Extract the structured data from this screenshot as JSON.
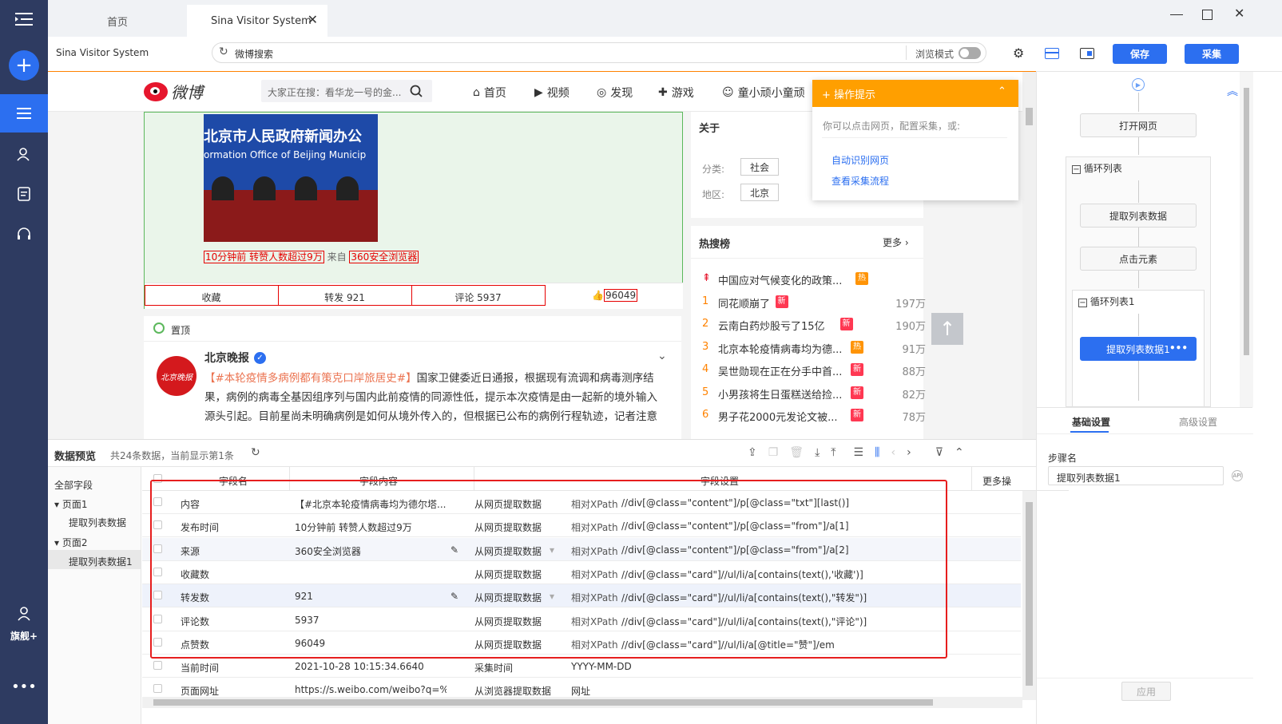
{
  "tabs": [
    {
      "label": "首页"
    },
    {
      "label": "Sina Visitor System"
    }
  ],
  "addr": {
    "title": "Sina Visitor System",
    "url": "微博搜索",
    "mode_label": "浏览模式",
    "save": "保存",
    "collect": "采集"
  },
  "nav": {
    "user_label": "旗舰+"
  },
  "weibo": {
    "logo": "微博",
    "search_placeholder": "大家正在搜：看华龙一号的金...",
    "nav": [
      "首页",
      "视频",
      "发现",
      "游戏",
      "童小顽小童顽"
    ],
    "post_image_text1": "北京市人民政府新闻办公",
    "post_image_text2": "ormation Office of Beijing Municip",
    "meta_time": "10分钟前 转赞人数超过9万",
    "meta_from": "来自",
    "meta_source": "360安全浏览器",
    "actions": [
      "收藏",
      "转发 921",
      "评论 5937"
    ],
    "likes": "96049",
    "top_label": "置顶",
    "author": "北京晚报",
    "avatar_text": "北京晚报",
    "post_tag": "【#本轮疫情多病例都有策克口岸旅居史#】",
    "post_text": "国家卫健委近日通报，根据现有流调和病毒测序结果，病例的病毒全基因组序列与国内此前疫情的同源性低，提示本次疫情是由一起新的境外输入源头引起。目前星尚未明确病例是如何从境外传入的，但根据已公布的病例行程轨迹，记者注意",
    "about_title": "关于",
    "category_label": "分类:",
    "category_value": "社会",
    "region_label": "地区:",
    "region_value": "北京",
    "hot_title": "热搜榜",
    "hot_more": "更多",
    "hot_items": [
      {
        "rank": "",
        "text": "中国应对气候变化的政策...",
        "badge": "热",
        "count": ""
      },
      {
        "rank": "1",
        "text": "同花顺崩了",
        "badge": "新",
        "count": "197万"
      },
      {
        "rank": "2",
        "text": "云南白药炒股亏了15亿",
        "badge": "新",
        "count": "190万"
      },
      {
        "rank": "3",
        "text": "北京本轮疫情病毒均为德...",
        "badge": "热",
        "count": "91万"
      },
      {
        "rank": "4",
        "text": "吴世勋现在正在分手中首...",
        "badge": "新",
        "count": "88万"
      },
      {
        "rank": "5",
        "text": "小男孩将生日蛋糕送给捡...",
        "badge": "新",
        "count": "82万"
      },
      {
        "rank": "6",
        "text": "男子花2000元发论文被...",
        "badge": "新",
        "count": "78万"
      }
    ]
  },
  "tips": {
    "title": "操作提示",
    "desc": "你可以点击网页，配置采集，或:",
    "link1": "自动识别网页",
    "link2": "查看采集流程"
  },
  "flow": {
    "open": "打开网页",
    "loop1": "循环列表",
    "extract": "提取列表数据",
    "click": "点击元素",
    "loop2": "循环列表1",
    "extract1": "提取列表数据1"
  },
  "step": {
    "tab1": "基础设置",
    "tab2": "高级设置",
    "name_label": "步骤名",
    "name_value": "提取列表数据1",
    "apply": "应用"
  },
  "preview": {
    "title": "数据预览",
    "info": "共24条数据，当前显示第1条",
    "tree": [
      "全部字段",
      "页面1",
      "提取列表数据",
      "页面2",
      "提取列表数据1"
    ],
    "headers": [
      "字段名",
      "字段内容",
      "字段设置",
      "更多操"
    ],
    "rows": [
      {
        "name": "内容",
        "content": "【#北京本轮疫情病毒均为德尔塔...",
        "type": "从网页提取数据",
        "mode": "相对XPath",
        "xpath": "//div[@class=\"content\"]/p[@class=\"txt\"][last()]"
      },
      {
        "name": "发布时间",
        "content": "10分钟前 转赞人数超过9万",
        "type": "从网页提取数据",
        "mode": "相对XPath",
        "xpath": "//div[@class=\"content\"]/p[@class=\"from\"]/a[1]"
      },
      {
        "name": "来源",
        "content": "360安全浏览器",
        "type": "从网页提取数据",
        "mode": "相对XPath",
        "xpath": "//div[@class=\"content\"]/p[@class=\"from\"]/a[2]"
      },
      {
        "name": "收藏数",
        "content": "",
        "type": "从网页提取数据",
        "mode": "相对XPath",
        "xpath": "//div[@class=\"card\"]//ul/li/a[contains(text(),'收藏')]"
      },
      {
        "name": "转发数",
        "content": "921",
        "type": "从网页提取数据",
        "mode": "相对XPath",
        "xpath": "//div[@class=\"card\"]//ul/li/a[contains(text(),\"转发\")]"
      },
      {
        "name": "评论数",
        "content": "5937",
        "type": "从网页提取数据",
        "mode": "相对XPath",
        "xpath": "//div[@class=\"card\"]//ul/li/a[contains(text(),\"评论\")]"
      },
      {
        "name": "点赞数",
        "content": "96049",
        "type": "从网页提取数据",
        "mode": "相对XPath",
        "xpath": "//div[@class=\"card\"]//ul/li/a[@title=\"赞\"]/em"
      },
      {
        "name": "当前时间",
        "content": "2021-10-28 10:15:34.6640",
        "type": "采集时间",
        "mode": "YYYY-MM-DD HH:mm:ss.SSSS",
        "xpath": ""
      },
      {
        "name": "页面网址",
        "content": "https://s.weibo.com/weibo?q=%23...",
        "type": "从浏览器提取数据",
        "mode": "网址",
        "xpath": ""
      }
    ]
  }
}
